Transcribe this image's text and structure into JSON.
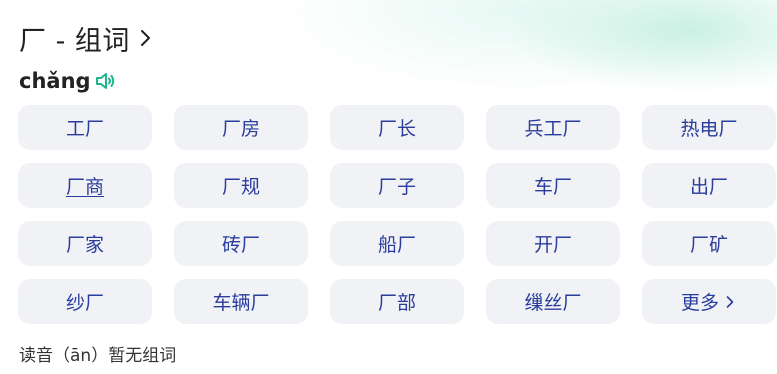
{
  "header": {
    "title": "厂 - 组词"
  },
  "pinyin": {
    "text": "chǎng",
    "audio_icon": "speaker-icon",
    "accent_color": "#1db58a"
  },
  "words": [
    "工厂",
    "厂房",
    "厂长",
    "兵工厂",
    "热电厂",
    "厂商",
    "厂规",
    "厂子",
    "车厂",
    "出厂",
    "厂家",
    "砖厂",
    "船厂",
    "开厂",
    "厂矿",
    "纱厂",
    "车辆厂",
    "厂部",
    "缫丝厂"
  ],
  "more": {
    "label": "更多"
  },
  "footer": {
    "note": "读音（ān）暂无组词"
  },
  "colors": {
    "word_text": "#2a3c9c",
    "cell_bg": "#f1f2f6"
  }
}
